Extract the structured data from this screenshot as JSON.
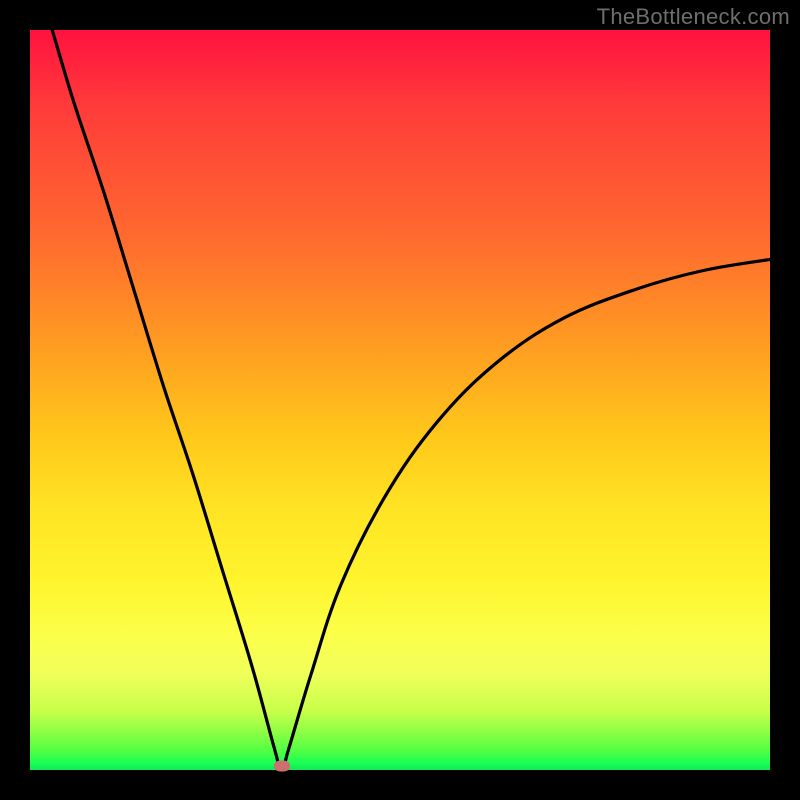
{
  "watermark": "TheBottleneck.com",
  "colors": {
    "frame": "#000000",
    "top": "#ff123f",
    "mid": "#ffe424",
    "bottom": "#10e85a",
    "curve": "#000000",
    "marker": "#cc6f6f",
    "watermark_text": "#6e6e6e"
  },
  "chart_data": {
    "type": "line",
    "title": "",
    "xlabel": "",
    "ylabel": "",
    "xlim": [
      0,
      100
    ],
    "ylim": [
      0,
      100
    ],
    "grid": false,
    "legend": false,
    "notes": "V-shaped bottleneck curve. Background gradient maps y=100 (top) to red (high bottleneck) and y=0 (bottom) to green (no bottleneck). Curve minimum at x≈34, y≈0. Left branch steep; right branch asymptotic, ending near y≈69 at x=100.",
    "series": [
      {
        "name": "bottleneck-curve",
        "x": [
          3,
          6,
          10,
          14,
          18,
          22,
          26,
          30,
          33,
          34,
          35,
          38,
          42,
          48,
          55,
          63,
          72,
          82,
          91,
          100
        ],
        "y": [
          100,
          90,
          78,
          65,
          52,
          40,
          27,
          14,
          3,
          0,
          3,
          13,
          25,
          37,
          47,
          55,
          61,
          65,
          67.5,
          69
        ]
      }
    ],
    "annotations": [
      {
        "type": "marker",
        "shape": "rounded-rect",
        "x": 34,
        "y": 0.5,
        "label": "optimal-point"
      }
    ]
  }
}
